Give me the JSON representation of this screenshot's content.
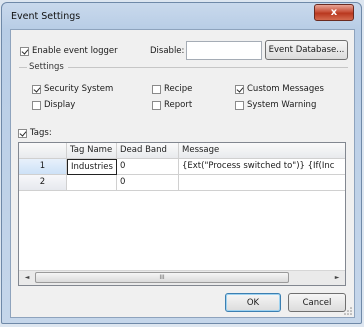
{
  "window": {
    "title": "Event Settings",
    "close_glyph": "x"
  },
  "top": {
    "enable_label": "Enable event logger",
    "enable_checked": true,
    "disable_label": "Disable:",
    "disable_value": "",
    "database_button": "Event Database..."
  },
  "settings": {
    "group_label": "Settings",
    "options": [
      {
        "label": "Security System",
        "checked": true
      },
      {
        "label": "Recipe",
        "checked": false
      },
      {
        "label": "Custom Messages",
        "checked": true
      },
      {
        "label": "Display",
        "checked": false
      },
      {
        "label": "Report",
        "checked": false
      },
      {
        "label": "System Warning",
        "checked": false
      }
    ]
  },
  "tags": {
    "label": "Tags:",
    "checked": true,
    "columns": [
      "Tag Name",
      "Dead Band",
      "Message"
    ],
    "rows": [
      {
        "num": "1",
        "tag": "Industries",
        "dead_band": "0",
        "message": "{Ext(\"Process switched to\")} {If(Inc"
      },
      {
        "num": "2",
        "tag": "",
        "dead_band": "0",
        "message": ""
      }
    ],
    "scroll_left": "◄",
    "scroll_right": "►",
    "scroll_grip": "III"
  },
  "buttons": {
    "ok": "OK",
    "cancel": "Cancel"
  }
}
